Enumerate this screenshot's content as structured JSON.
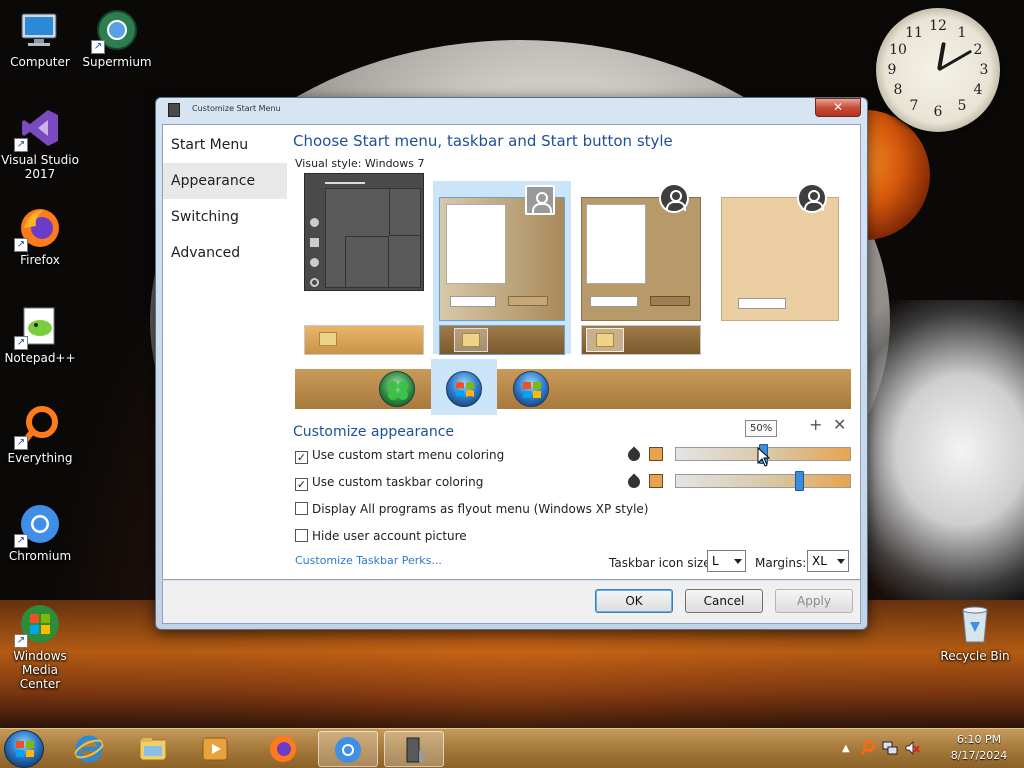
{
  "desktop": {
    "icons": [
      {
        "label": "Computer"
      },
      {
        "label": "Supermium"
      },
      {
        "label": "Visual Studio 2017"
      },
      {
        "label": "Firefox"
      },
      {
        "label": "Notepad++"
      },
      {
        "label": "Everything"
      },
      {
        "label": "Chromium"
      },
      {
        "label": "Windows Media Center"
      },
      {
        "label": "Recycle Bin"
      }
    ],
    "clock": {
      "numbers": [
        "12",
        "1",
        "2",
        "3",
        "4",
        "5",
        "6",
        "7",
        "8",
        "9",
        "10",
        "11"
      ]
    }
  },
  "dialog": {
    "title": "Customize Start Menu",
    "close_label": "✕",
    "nav": [
      "Start Menu",
      "Appearance",
      "Switching",
      "Advanced"
    ],
    "active_nav": "Appearance",
    "heading": "Choose Start menu, taskbar and Start button style",
    "visual_style": "Visual style:  Windows 7",
    "customize_heading": "Customize appearance",
    "plus_label": "+",
    "x_label": "✕",
    "checkboxes": [
      {
        "label": "Use custom start menu coloring",
        "checked": true
      },
      {
        "label": "Use custom taskbar coloring",
        "checked": true
      },
      {
        "label": "Display All programs as flyout menu (Windows XP style)",
        "checked": false
      },
      {
        "label": "Hide user account picture",
        "checked": false
      }
    ],
    "check_mark": "✓",
    "slider_tooltip": "50%",
    "slider1_value": 50,
    "slider2_value": 72,
    "link": "Customize Taskbar Perks...",
    "taskbar_icon_size_label": "Taskbar icon size:",
    "taskbar_icon_size_value": "L",
    "margins_label": "Margins:",
    "margins_value": "XL",
    "buttons": {
      "ok": "OK",
      "cancel": "Cancel",
      "apply": "Apply"
    },
    "colors": {
      "accent": "#e8a24e",
      "heading": "#1e4f9c",
      "link": "#2a7bc7"
    }
  },
  "taskbar": {
    "time": "6:10 PM",
    "date": "8/17/2024"
  }
}
